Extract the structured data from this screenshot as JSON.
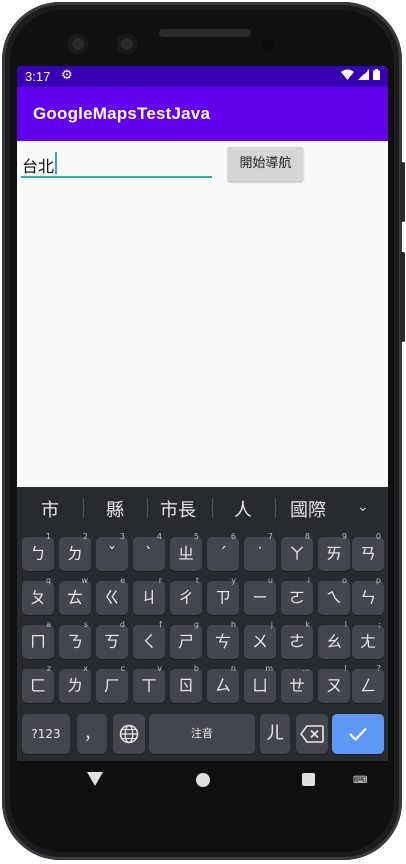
{
  "status": {
    "time": "3:17"
  },
  "app": {
    "title": "GoogleMapsTestJava"
  },
  "form": {
    "destination_value": "台北",
    "navigate_label": "開始導航"
  },
  "suggestions": [
    "市",
    "縣",
    "市長",
    "人",
    "國際"
  ],
  "keyboard": {
    "rows": [
      [
        [
          "ㄅ",
          "1"
        ],
        [
          "ㄉ",
          "2"
        ],
        [
          "ˇ",
          "3"
        ],
        [
          "ˋ",
          "4"
        ],
        [
          "ㄓ",
          "5"
        ],
        [
          "ˊ",
          "6"
        ],
        [
          "˙",
          "7"
        ],
        [
          "ㄚ",
          "8"
        ],
        [
          "ㄞ",
          "9"
        ],
        [
          "ㄢ",
          "0"
        ]
      ],
      [
        [
          "ㄆ",
          "q"
        ],
        [
          "ㄊ",
          "w"
        ],
        [
          "ㄍ",
          "e"
        ],
        [
          "ㄐ",
          "r"
        ],
        [
          "ㄔ",
          "t"
        ],
        [
          "ㄗ",
          "y"
        ],
        [
          "ㄧ",
          "u"
        ],
        [
          "ㄛ",
          "i"
        ],
        [
          "ㄟ",
          "o"
        ],
        [
          "ㄣ",
          "p"
        ]
      ],
      [
        [
          "ㄇ",
          "a"
        ],
        [
          "ㄋ",
          "s"
        ],
        [
          "ㄎ",
          "d"
        ],
        [
          "ㄑ",
          "f"
        ],
        [
          "ㄕ",
          "g"
        ],
        [
          "ㄘ",
          "h"
        ],
        [
          "ㄨ",
          "j"
        ],
        [
          "ㄜ",
          "k"
        ],
        [
          "ㄠ",
          "l"
        ],
        [
          "ㄤ",
          ";"
        ]
      ],
      [
        [
          "ㄈ",
          "z"
        ],
        [
          "ㄌ",
          "x"
        ],
        [
          "ㄏ",
          "c"
        ],
        [
          "ㄒ",
          "v"
        ],
        [
          "ㄖ",
          "b"
        ],
        [
          "ㄙ",
          "n"
        ],
        [
          "ㄩ",
          "m"
        ],
        [
          "ㄝ",
          "…"
        ],
        [
          "ㄡ",
          "!"
        ],
        [
          "ㄥ",
          "?"
        ]
      ]
    ],
    "symbols_label": "?123",
    "punct_label": "，",
    "space_label": "注音",
    "er_label": "ㄦ",
    "accent_color": "#5e97f6"
  }
}
